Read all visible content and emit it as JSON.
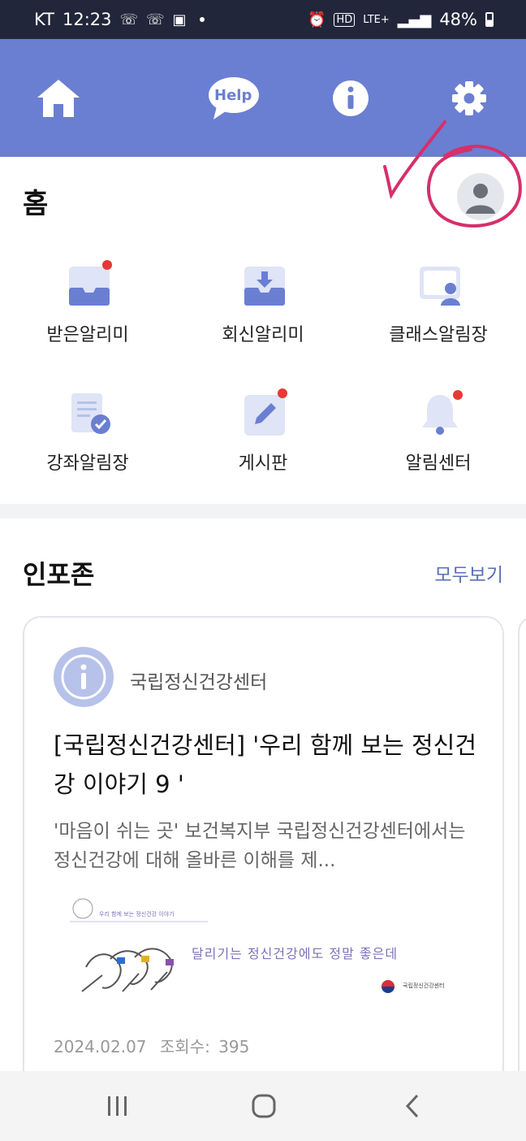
{
  "status_bar": {
    "carrier": "KT",
    "time": "12:23",
    "network": "LTE+",
    "battery": "48%"
  },
  "toolbar": {
    "icons": [
      "home-icon",
      "help-icon",
      "info-icon",
      "gear-icon"
    ],
    "help_label": "Help"
  },
  "home": {
    "title": "홈"
  },
  "menu": {
    "items": [
      {
        "label": "받은알리미",
        "icon": "inbox-icon",
        "badge": true
      },
      {
        "label": "회신알리미",
        "icon": "reply-inbox-icon",
        "badge": false
      },
      {
        "label": "클래스알림장",
        "icon": "class-notice-icon",
        "badge": false
      },
      {
        "label": "강좌알림장",
        "icon": "course-notice-icon",
        "badge": false
      },
      {
        "label": "게시판",
        "icon": "edit-board-icon",
        "badge": true
      },
      {
        "label": "알림센터",
        "icon": "bell-icon",
        "badge": true
      }
    ]
  },
  "infozone": {
    "title": "인포존",
    "see_all": "모두보기",
    "card": {
      "source": "국립정신건강센터",
      "title": "[국립정신건강센터] '우리 함께 보는 정신건강 이야기 9 '",
      "description": "'마음이 쉬는 곳' 보건복지부 국립정신건강센터에서는 정신건강에 대해 올바른 이해를 제...",
      "thumbnail_header": "우리 함께 보는 정신건강 이야기",
      "thumbnail_caption": "달리기는 정신건강에도 정말 좋은데",
      "thumbnail_org": "국립정신건강센터",
      "date": "2024.02.07",
      "views_label": "조회수:",
      "views": "395"
    }
  },
  "colors": {
    "status_bar": "#22263a",
    "toolbar": "#6a7fd1",
    "icon_blue": "#6a7fd1",
    "badge_red": "#e53935",
    "annotation_pink": "#d62f6b",
    "link": "#5a6fb4"
  }
}
